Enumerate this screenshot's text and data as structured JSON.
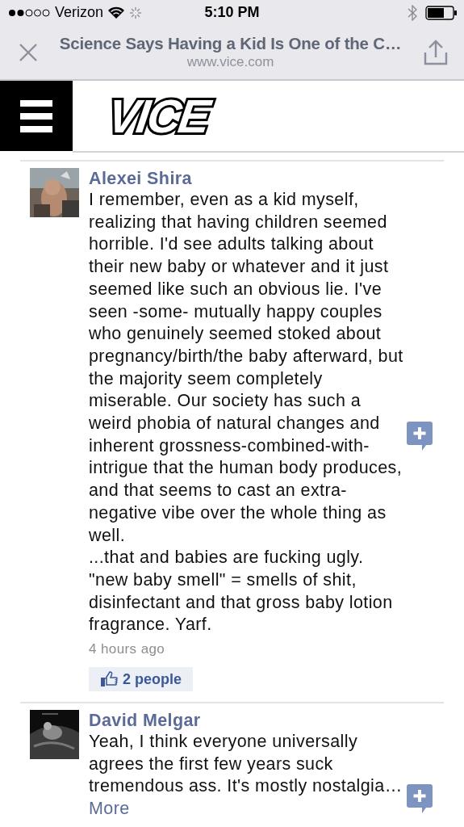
{
  "status_bar": {
    "carrier": "Verizon",
    "time": "5:10 PM"
  },
  "address_bar": {
    "title": "Science Says Having a Kid Is One of the C…",
    "url": "www.vice.com"
  },
  "site_header": {
    "logo": "VICE"
  },
  "comments": [
    {
      "author": "Alexei Shira",
      "avatar": {
        "kind": "picture"
      },
      "paragraphs": [
        "I remember, even as a kid myself, realizing that having children seemed horrible. I'd see adults talking about their new baby or whatever and it just seemed like such an obvious lie. I've seen -some- mutually happy couples who genuinely seemed stoked about pregnancy/birth/the baby afterward, but the majority seem completely miserable. Our society has such a weird phobia of natural changes and inherent grossness-combined-with-intrigue that the human body produces, and that seems to cast an extra-negative vibe over the whole thing as well.",
        "...that and babies are fucking ugly. \"new baby smell\" = smells of shit, disinfectant and that gross baby lotion fragrance. Yarf."
      ],
      "time": "4 hours ago",
      "likes": "2 people"
    },
    {
      "author": "David Melgar",
      "avatar": {
        "kind": "picture"
      },
      "paragraphs": [
        "Yeah, I think everyone universally agrees the first few years suck tremendous ass. It's mostly nostalgia…"
      ],
      "more": "More"
    }
  ]
}
